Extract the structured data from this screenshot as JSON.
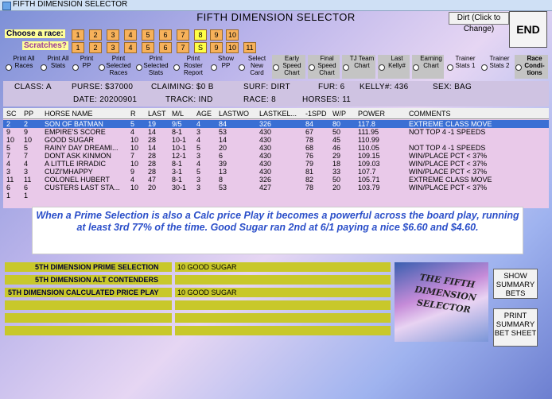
{
  "window_title": "FIFTH DIMENSION SELECTOR",
  "main_title": "FIFTH DIMENSION SELECTOR",
  "dirt_button": "Dirt (Click to Change)",
  "end_button": "END",
  "choose_race_label": "Choose a race:",
  "scratches_label": "Scratches?",
  "race_buttons": [
    "1",
    "2",
    "3",
    "4",
    "5",
    "6",
    "7",
    "8",
    "9",
    "10"
  ],
  "scratch_buttons": [
    "1",
    "2",
    "3",
    "4",
    "5",
    "6",
    "7",
    "S",
    "9",
    "10",
    "11"
  ],
  "options": [
    {
      "label": "Print All Races"
    },
    {
      "label": "Print All Stats"
    },
    {
      "label": "Print PP"
    },
    {
      "label": "Print Selected Races"
    },
    {
      "label": "Print Selected Stats"
    },
    {
      "label": "Print Roster Report"
    },
    {
      "label": "Show PP"
    },
    {
      "label": "Select New Card"
    },
    {
      "label": "Early Speed Chart"
    },
    {
      "label": "Final Speed Chart"
    },
    {
      "label": "TJ Team Chart"
    },
    {
      "label": "Last Kelly#"
    },
    {
      "label": "Earning Chart"
    },
    {
      "label": "Trainer Stats 1"
    },
    {
      "label": "Trainer Stats 2"
    },
    {
      "label": "Race Condi-tions"
    }
  ],
  "race_info": {
    "class": "CLASS:  A",
    "purse": "PURSE:  $37000",
    "claiming": "CLAIMING:  $0  B",
    "surf": "SURF:  DIRT",
    "fur": "FUR:  6",
    "kelly": "KELLY#:  436",
    "sex": "SEX:  BAG",
    "date": "DATE:  20200901",
    "track": "TRACK:  IND",
    "race": "RACE:  8",
    "horses": "HORSES:  11"
  },
  "table": {
    "headers": [
      "SC",
      "PP",
      "HORSE NAME",
      "R",
      "LAST",
      "M/L",
      "AGE",
      "LASTWO",
      "LASTKEL...",
      "-1SPD",
      "W/P",
      "POWER",
      "COMMENTS"
    ],
    "rows": [
      [
        "2",
        "2",
        "SON OF BATMAN",
        "5",
        "19",
        "9/5",
        "4",
        "84",
        "326",
        "84",
        "80",
        "117.8",
        "EXTREME CLASS MOVE"
      ],
      [
        "9",
        "9",
        "EMPIRE'S SCORE",
        "4",
        "14",
        "8-1",
        "3",
        "53",
        "430",
        "67",
        "50",
        "111.95",
        "NOT TOP 4 -1 SPEEDS"
      ],
      [
        "10",
        "10",
        "GOOD SUGAR",
        "10",
        "28",
        "10-1",
        "4",
        "14",
        "430",
        "78",
        "45",
        "110.99",
        ""
      ],
      [
        "5",
        "5",
        "RAINY DAY DREAMI...",
        "10",
        "14",
        "10-1",
        "5",
        "20",
        "430",
        "68",
        "46",
        "110.05",
        "NOT TOP 4 -1 SPEEDS"
      ],
      [
        "7",
        "7",
        "DONT ASK KINMON",
        "7",
        "28",
        "12-1",
        "3",
        "6",
        "430",
        "76",
        "29",
        "109.15",
        "WIN/PLACE PCT < 37%"
      ],
      [
        "4",
        "4",
        "A LITTLE IRRADIC",
        "10",
        "28",
        "8-1",
        "4",
        "39",
        "430",
        "79",
        "18",
        "109.03",
        "WIN/PLACE PCT < 37%"
      ],
      [
        "3",
        "3",
        "CUZI'MHAPPY",
        "9",
        "28",
        "3-1",
        "5",
        "13",
        "430",
        "81",
        "33",
        "107.7",
        "WIN/PLACE PCT < 37%"
      ],
      [
        "11",
        "11",
        "COLONEL HUBERT",
        "4",
        "47",
        "8-1",
        "3",
        "8",
        "326",
        "82",
        "50",
        "105.71",
        "EXTREME CLASS MOVE"
      ],
      [
        "6",
        "6",
        "CUSTERS LAST STA...",
        "10",
        "20",
        "30-1",
        "3",
        "53",
        "427",
        "78",
        "20",
        "103.79",
        "WIN/PLACE PCT < 37%"
      ],
      [
        "1",
        "1",
        "",
        "",
        "",
        "",
        "",
        "",
        "",
        "",
        "",
        "",
        ""
      ]
    ]
  },
  "overlay_text": "When a Prime Selection is also a Calc price Play it becomes a powerful across the board play, running at least 3rd 77% of the time.  Good Sugar ran 2nd at 6/1 paying a nice $6.60 and $4.60.",
  "selections": {
    "prime_label": "5TH DIMENSION PRIME SELECTION",
    "prime_value": "10   GOOD SUGAR",
    "alt_label": "5TH DIMENSION ALT CONTENDERS",
    "calc_label": "5TH DIMENSION CALCULATED PRICE PLAY",
    "calc_value": "10   GOOD SUGAR"
  },
  "logo_text": "THE FIFTH DIMENSION SELECTOR",
  "show_summary_button": "SHOW SUMMARY BETS",
  "print_summary_button": "PRINT SUMMARY BET SHEET"
}
